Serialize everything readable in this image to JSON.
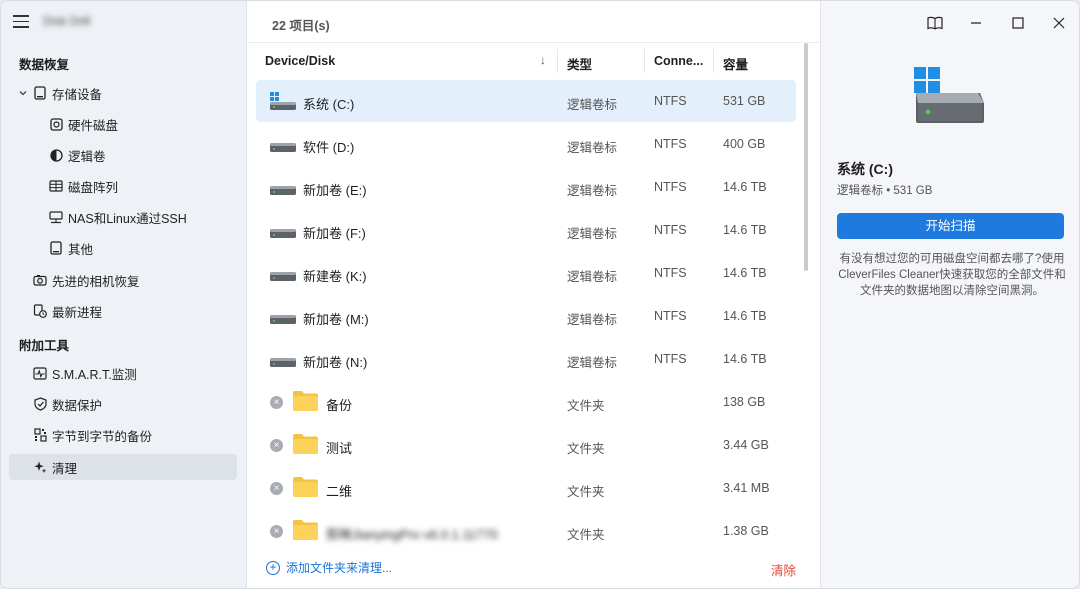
{
  "app": {
    "title": "Disk Drill"
  },
  "sidebar": {
    "section_recovery": "数据恢复",
    "section_tools": "附加工具",
    "storage": "存储设备",
    "items": [
      {
        "label": "硬件磁盘",
        "icon": "hard-disk-icon"
      },
      {
        "label": "逻辑卷",
        "icon": "logical-volume-icon"
      },
      {
        "label": "磁盘阵列",
        "icon": "raid-icon"
      },
      {
        "label": "NAS和Linux通过SSH",
        "icon": "network-icon"
      },
      {
        "label": "其他",
        "icon": "other-device-icon"
      },
      {
        "label": "先进的相机恢复",
        "icon": "camera-icon"
      },
      {
        "label": "最新进程",
        "icon": "recent-sessions-icon"
      },
      {
        "label": "S.M.A.R.T.监测",
        "icon": "smart-monitor-icon"
      },
      {
        "label": "数据保护",
        "icon": "shield-icon"
      },
      {
        "label": "字节到字节的备份",
        "icon": "backup-icon"
      },
      {
        "label": "清理",
        "icon": "sparkle-icon"
      }
    ]
  },
  "main": {
    "item_count": "22 项目(s)",
    "columns": {
      "device": "Device/Disk",
      "type": "类型",
      "conn": "Conne...",
      "size": "容量"
    },
    "drives": [
      {
        "name": "系统 (C:)",
        "type": "逻辑卷标",
        "fs": "NTFS",
        "size": "531 GB",
        "icon": "windows-drive-icon"
      },
      {
        "name": "软件 (D:)",
        "type": "逻辑卷标",
        "fs": "NTFS",
        "size": "400 GB",
        "icon": "drive-icon"
      },
      {
        "name": "新加卷 (E:)",
        "type": "逻辑卷标",
        "fs": "NTFS",
        "size": "14.6 TB",
        "icon": "drive-icon"
      },
      {
        "name": "新加卷 (F:)",
        "type": "逻辑卷标",
        "fs": "NTFS",
        "size": "14.6 TB",
        "icon": "drive-icon"
      },
      {
        "name": "新建卷 (K:)",
        "type": "逻辑卷标",
        "fs": "NTFS",
        "size": "14.6 TB",
        "icon": "drive-icon"
      },
      {
        "name": "新加卷 (M:)",
        "type": "逻辑卷标",
        "fs": "NTFS",
        "size": "14.6 TB",
        "icon": "drive-icon"
      },
      {
        "name": "新加卷 (N:)",
        "type": "逻辑卷标",
        "fs": "NTFS",
        "size": "14.6 TB",
        "icon": "drive-icon"
      }
    ],
    "folders": [
      {
        "name": "备份",
        "type": "文件夹",
        "size": "138 GB"
      },
      {
        "name": "测试",
        "type": "文件夹",
        "size": "3.44 GB"
      },
      {
        "name": "二维",
        "type": "文件夹",
        "size": "3.41 MB"
      },
      {
        "name": "剪映JianyingPro v6.0.1.11770",
        "type": "文件夹",
        "size": "1.38 GB"
      }
    ],
    "add_folder": "添加文件夹来清理...",
    "clear": "清除"
  },
  "details": {
    "name": "系统 (C:)",
    "subtitle": "逻辑卷标 • 531 GB",
    "scan_button": "开始扫描",
    "promo": "有没有想过您的可用磁盘空间都去哪了?使用CleverFiles Cleaner快速获取您的全部文件和文件夹的数据地图以清除空间黑洞。"
  },
  "colors": {
    "accent": "#1f7ae0",
    "danger": "#e1473d",
    "selected_row": "#e3effb"
  }
}
